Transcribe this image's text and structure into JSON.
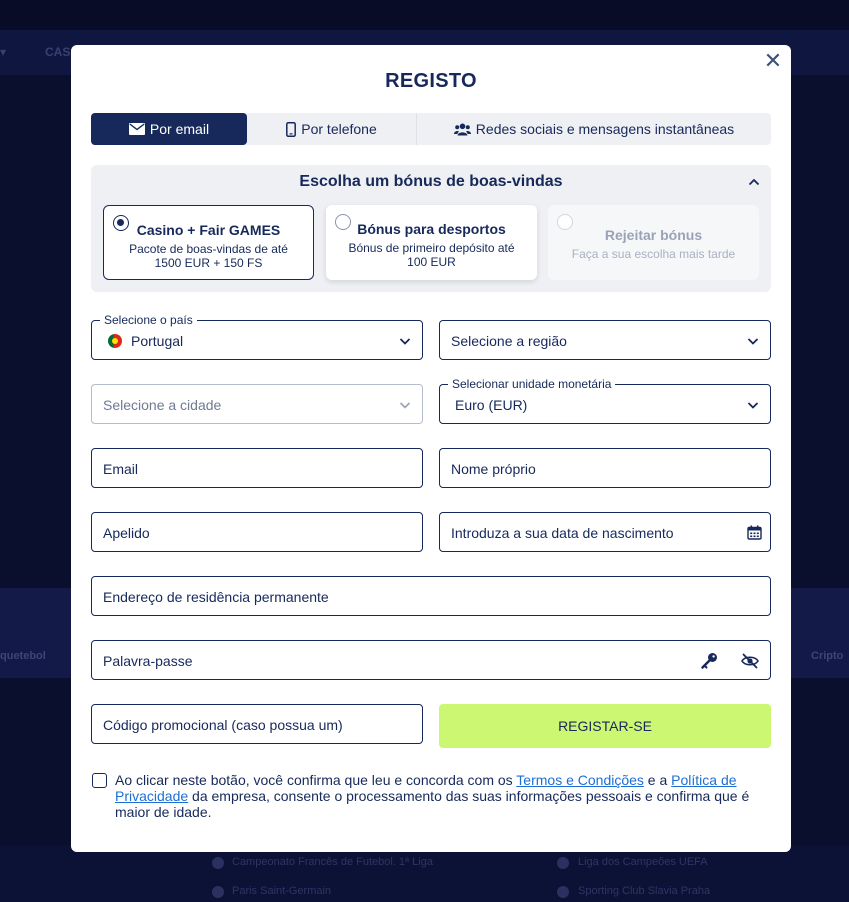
{
  "background": {
    "nav_items": [
      "CAS"
    ],
    "tiles": [
      "quetebol",
      "Cripto"
    ],
    "list": [
      "Campeonato Francês de Futebol. 1ª Liga",
      "Paris Saint-Germain",
      "Liga dos Campeões UEFA",
      "Sporting Club Slavia Praha"
    ]
  },
  "modal": {
    "title": "REGISTO",
    "close_icon": "close-icon",
    "tabs": [
      {
        "label": "Por email",
        "icon": "envelope-icon",
        "active": true
      },
      {
        "label": "Por telefone",
        "icon": "phone-icon",
        "active": false
      },
      {
        "label": "Redes sociais e mensagens instantâneas",
        "icon": "users-icon",
        "active": false
      }
    ],
    "bonus": {
      "heading": "Escolha um bónus de boas-vindas",
      "options": [
        {
          "title": "Casino + Fair GAMES",
          "desc": "Pacote de boas-vindas de até 1500 EUR + 150 FS",
          "selected": true
        },
        {
          "title": "Bónus para desportos",
          "desc": "Bónus de primeiro depósito até 100 EUR",
          "selected": false
        },
        {
          "title": "Rejeitar bónus",
          "desc": "Faça a sua escolha mais tarde",
          "selected": false
        }
      ]
    },
    "form": {
      "country_label": "Selecione o país",
      "country_value": "Portugal",
      "region_placeholder": "Selecione a região",
      "city_placeholder": "Selecione a cidade",
      "currency_label": "Selecionar unidade monetária",
      "currency_value": "Euro (EUR)",
      "email_placeholder": "Email",
      "first_name_placeholder": "Nome próprio",
      "last_name_placeholder": "Apelido",
      "birthdate_placeholder": "Introduza a sua data de nascimento",
      "address_placeholder": "Endereço de residência permanente",
      "password_placeholder": "Palavra-passe",
      "promo_placeholder": "Código promocional (caso possua um)",
      "register_label": "REGISTAR-SE"
    },
    "consent": {
      "text_1": "Ao clicar neste botão, você confirma que leu e concorda com os ",
      "terms_link": "Termos e Condições",
      "text_2": " e a ",
      "privacy_link": "Política de Privacidade",
      "text_3": " da empresa, consente o processamento das suas informações pessoais e confirma que é maior de idade."
    },
    "colors": {
      "primary": "#16295a",
      "accent": "#ccf772",
      "link": "#1d6fd6"
    }
  }
}
